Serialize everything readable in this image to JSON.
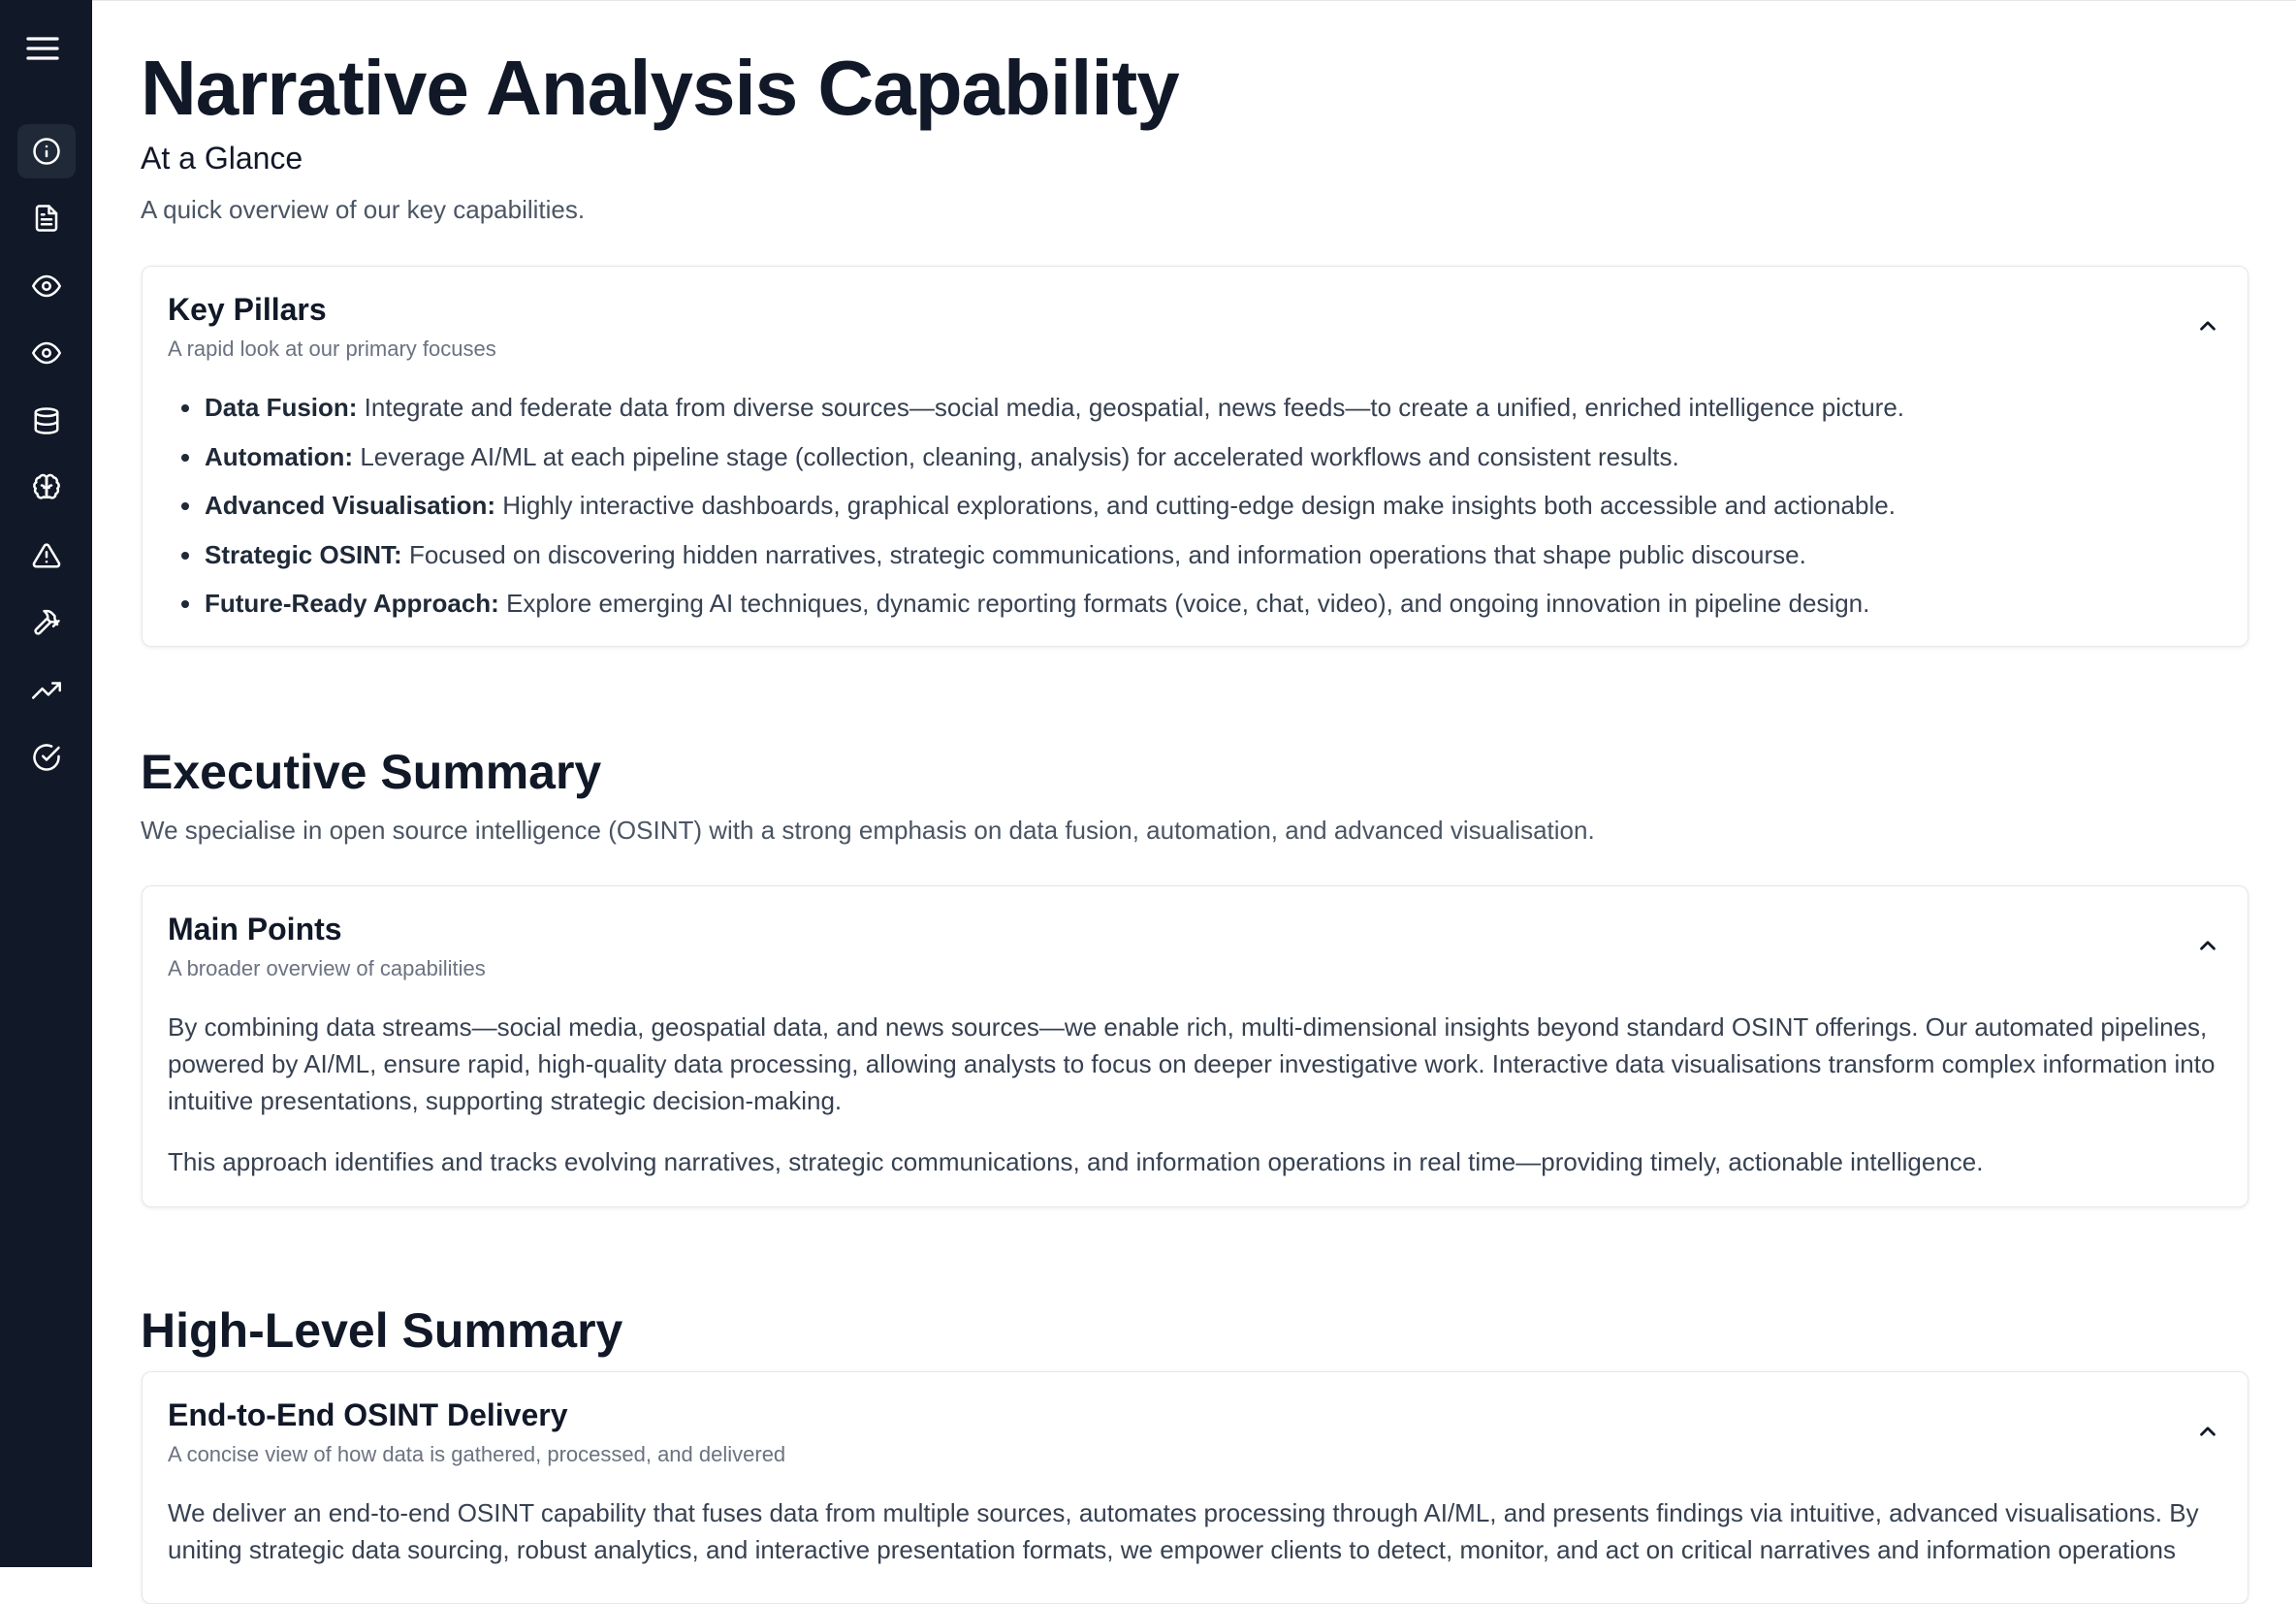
{
  "sidebar": {
    "menu_icon": "hamburger-menu-icon",
    "items": [
      {
        "icon": "info-icon",
        "active": true
      },
      {
        "icon": "document-icon",
        "active": false
      },
      {
        "icon": "eye-icon",
        "active": false
      },
      {
        "icon": "eye-icon",
        "active": false
      },
      {
        "icon": "database-icon",
        "active": false
      },
      {
        "icon": "brain-icon",
        "active": false
      },
      {
        "icon": "alert-triangle-icon",
        "active": false
      },
      {
        "icon": "hammer-icon",
        "active": false
      },
      {
        "icon": "trending-up-icon",
        "active": false
      },
      {
        "icon": "check-circle-icon",
        "active": false
      }
    ]
  },
  "header": {
    "title": "Narrative Analysis Capability",
    "subtitle": "At a Glance",
    "description": "A quick overview of our key capabilities."
  },
  "key_pillars": {
    "title": "Key Pillars",
    "subtitle": "A rapid look at our primary focuses",
    "items": [
      {
        "label": "Data Fusion:",
        "text": " Integrate and federate data from diverse sources—social media, geospatial, news feeds—to create a unified, enriched intelligence picture."
      },
      {
        "label": "Automation:",
        "text": " Leverage AI/ML at each pipeline stage (collection, cleaning, analysis) for accelerated workflows and consistent results."
      },
      {
        "label": "Advanced Visualisation:",
        "text": " Highly interactive dashboards, graphical explorations, and cutting-edge design make insights both accessible and actionable."
      },
      {
        "label": "Strategic OSINT:",
        "text": " Focused on discovering hidden narratives, strategic communications, and information operations that shape public discourse."
      },
      {
        "label": "Future-Ready Approach:",
        "text": " Explore emerging AI techniques, dynamic reporting formats (voice, chat, video), and ongoing innovation in pipeline design."
      }
    ]
  },
  "executive_summary": {
    "heading": "Executive Summary",
    "description": "We specialise in open source intelligence (OSINT) with a strong emphasis on data fusion, automation, and advanced visualisation.",
    "card": {
      "title": "Main Points",
      "subtitle": "A broader overview of capabilities",
      "paragraphs": [
        "By combining data streams—social media, geospatial data, and news sources—we enable rich, multi-dimensional insights beyond standard OSINT offerings. Our automated pipelines, powered by AI/ML, ensure rapid, high-quality data processing, allowing analysts to focus on deeper investigative work. Interactive data visualisations transform complex information into intuitive presentations, supporting strategic decision-making.",
        "This approach identifies and tracks evolving narratives, strategic communications, and information operations in real time—providing timely, actionable intelligence."
      ]
    }
  },
  "high_level_summary": {
    "heading": "High-Level Summary",
    "card": {
      "title": "End-to-End OSINT Delivery",
      "subtitle": "A concise view of how data is gathered, processed, and delivered",
      "paragraph": "We deliver an end-to-end OSINT capability that fuses data from multiple sources, automates processing through AI/ML, and presents findings via intuitive, advanced visualisations. By uniting strategic data sourcing, robust analytics, and interactive presentation formats, we empower clients to detect, monitor, and act on critical narratives and information operations"
    }
  },
  "colors": {
    "sidebar_bg": "#111827",
    "sidebar_active": "#1f2937",
    "icon_color": "#ffffff",
    "text_primary": "#111827",
    "text_secondary": "#4b5563",
    "card_border": "#e5e7eb"
  }
}
